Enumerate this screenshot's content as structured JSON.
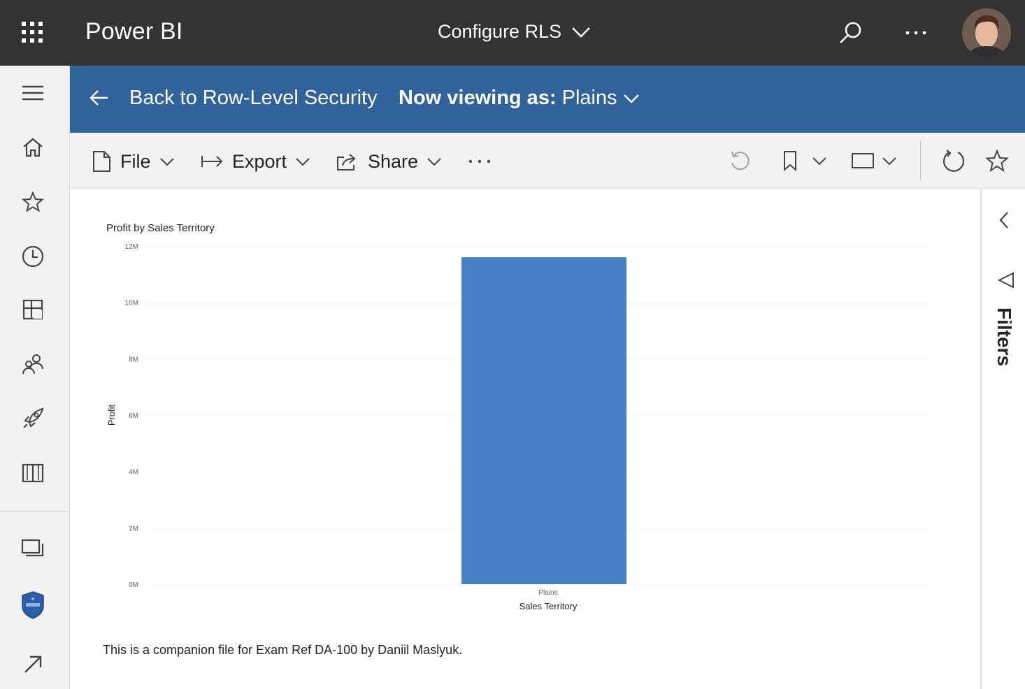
{
  "header": {
    "brand": "Power BI",
    "report_title": "Configure RLS",
    "icons": [
      "app-launcher-icon",
      "chevron-down-icon",
      "search-icon",
      "more-options-icon",
      "profile-avatar"
    ]
  },
  "left_nav": {
    "items": [
      {
        "name": "menu",
        "icon": "hamburger-icon"
      },
      {
        "name": "home",
        "icon": "home-icon"
      },
      {
        "name": "favorites",
        "icon": "star-icon"
      },
      {
        "name": "recent",
        "icon": "clock-icon"
      },
      {
        "name": "apps",
        "icon": "apps-icon"
      },
      {
        "name": "shared",
        "icon": "shared-with-me-icon"
      },
      {
        "name": "deployment",
        "icon": "rocket-icon"
      },
      {
        "name": "learn",
        "icon": "book-icon"
      },
      {
        "name": "workspaces",
        "icon": "workspaces-icon"
      },
      {
        "name": "my-workspace",
        "icon": "workspace-badge-icon"
      },
      {
        "name": "get-data",
        "icon": "arrow-up-right-icon"
      }
    ]
  },
  "banner": {
    "back_label": "Back to Row-Level Security",
    "viewing_prefix": "Now viewing as:",
    "viewing_role": "Plains"
  },
  "toolbar": {
    "file_label": "File",
    "export_label": "Export",
    "share_label": "Share",
    "more_label": "···",
    "icons": [
      "reset-icon",
      "bookmark-icon",
      "view-icon",
      "refresh-icon",
      "favorite-star-icon"
    ]
  },
  "chart_data": {
    "type": "bar",
    "title": "Profit by Sales Territory",
    "xlabel": "Sales Territory",
    "ylabel": "Profit",
    "categories": [
      "Plains"
    ],
    "values": [
      11.6
    ],
    "value_unit": "M",
    "ylim": [
      0,
      12
    ],
    "yticks": [
      "0M",
      "2M",
      "4M",
      "6M",
      "8M",
      "10M",
      "12M"
    ],
    "grid": true,
    "bar_color": "#4681c6"
  },
  "footnote": "This is a companion file for Exam Ref DA-100 by Daniil Maslyuk.",
  "filters_pane": {
    "label": "Filters"
  },
  "colors": {
    "topbar": "#333333",
    "banner": "#2f6399",
    "toolbar": "#f3f2f1",
    "bar": "#4681c6"
  }
}
